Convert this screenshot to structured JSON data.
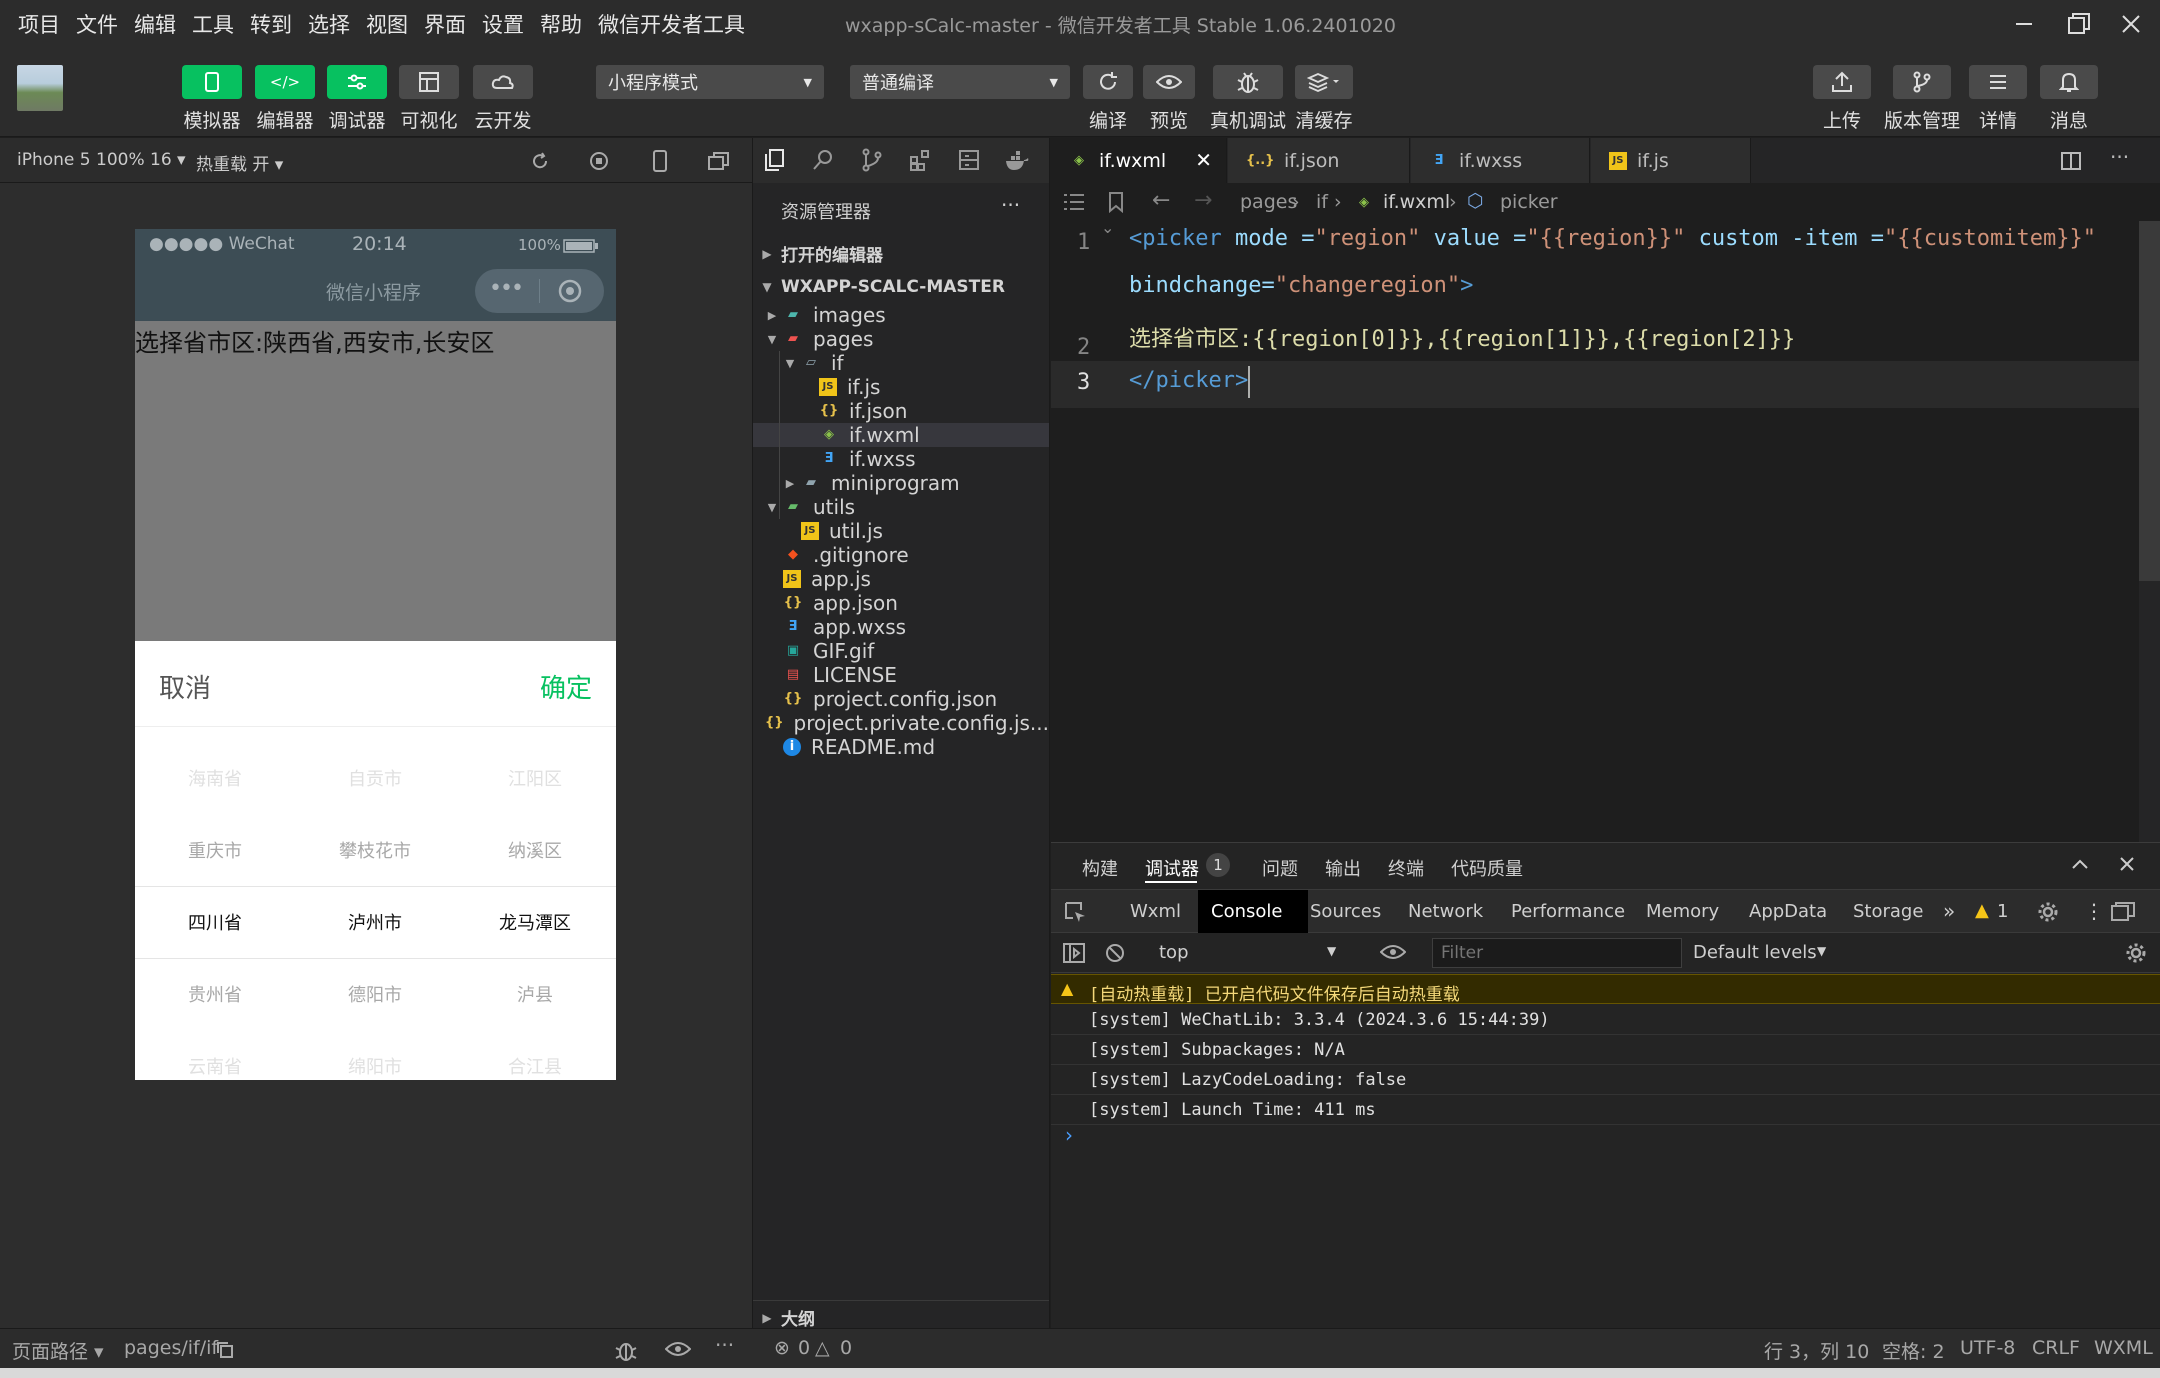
{
  "window": {
    "title": "wxapp-sCalc-master - 微信开发者工具 Stable 1.06.2401020"
  },
  "menu": [
    "项目",
    "文件",
    "编辑",
    "工具",
    "转到",
    "选择",
    "视图",
    "界面",
    "设置",
    "帮助",
    "微信开发者工具"
  ],
  "toolbar": {
    "simulator": "模拟器",
    "editor": "编辑器",
    "debugger": "调试器",
    "visual": "可视化",
    "cloud": "云开发",
    "mode": "小程序模式",
    "compile_mode": "普通编译",
    "compile": "编译",
    "preview": "预览",
    "real_debug": "真机调试",
    "clear_cache": "清缓存",
    "upload": "上传",
    "version": "版本管理",
    "details": "详情",
    "messages": "消息"
  },
  "simulator": {
    "device": "iPhone 5 100% 16",
    "hot_reload": "热重载 开",
    "status_wechat": "●●●●● WeChat",
    "status_time": "20:14",
    "status_battery": "100%",
    "nav_title": "微信小程序",
    "content_text": "选择省市区:陕西省,西安市,长安区",
    "cancel": "取消",
    "confirm": "确定",
    "rows": [
      [
        "海南省",
        "自贡市",
        "江阳区"
      ],
      [
        "重庆市",
        "攀枝花市",
        "纳溪区"
      ],
      [
        "四川省",
        "泸州市",
        "龙马潭区"
      ],
      [
        "贵州省",
        "德阳市",
        "泸县"
      ],
      [
        "云南省",
        "绵阳市",
        "合江县"
      ]
    ]
  },
  "explorer": {
    "title": "资源管理器",
    "open_editors": "打开的编辑器",
    "project": "WXAPP-SCALC-MASTER",
    "outline": "大纲",
    "items": [
      {
        "label": "images",
        "icon": "folder-images",
        "level": 1,
        "arrow": "▸"
      },
      {
        "label": "pages",
        "icon": "folder-pages",
        "level": 1,
        "arrow": "▾"
      },
      {
        "label": "if",
        "icon": "folder-open",
        "level": 2,
        "arrow": "▾"
      },
      {
        "label": "if.js",
        "icon": "js",
        "level": 3,
        "arrow": ""
      },
      {
        "label": "if.json",
        "icon": "json",
        "level": 3,
        "arrow": ""
      },
      {
        "label": "if.wxml",
        "icon": "wxml",
        "level": 3,
        "arrow": ""
      },
      {
        "label": "if.wxss",
        "icon": "wxss",
        "level": 3,
        "arrow": ""
      },
      {
        "label": "miniprogram",
        "icon": "folder",
        "level": 2,
        "arrow": "▸"
      },
      {
        "label": "utils",
        "icon": "folder-utils",
        "level": 1,
        "arrow": "▾"
      },
      {
        "label": "util.js",
        "icon": "js",
        "level": 2,
        "arrow": ""
      },
      {
        "label": ".gitignore",
        "icon": "git",
        "level": 1,
        "arrow": ""
      },
      {
        "label": "app.js",
        "icon": "js",
        "level": 1,
        "arrow": ""
      },
      {
        "label": "app.json",
        "icon": "json",
        "level": 1,
        "arrow": ""
      },
      {
        "label": "app.wxss",
        "icon": "wxss",
        "level": 1,
        "arrow": ""
      },
      {
        "label": "GIF.gif",
        "icon": "gif",
        "level": 1,
        "arrow": ""
      },
      {
        "label": "LICENSE",
        "icon": "license",
        "level": 1,
        "arrow": ""
      },
      {
        "label": "project.config.json",
        "icon": "json",
        "level": 1,
        "arrow": ""
      },
      {
        "label": "project.private.config.js...",
        "icon": "json",
        "level": 1,
        "arrow": ""
      },
      {
        "label": "README.md",
        "icon": "info",
        "level": 1,
        "arrow": ""
      }
    ]
  },
  "editor": {
    "tabs": [
      "if.wxml",
      "if.json",
      "if.wxss",
      "if.js"
    ],
    "breadcrumb": [
      "pages",
      "if",
      "if.wxml",
      "picker"
    ],
    "line_numbers": [
      "1",
      "2",
      "3"
    ],
    "line1a_tag": "<picker",
    "line1a_attr1": " mode =",
    "line1a_val1": "\"region\"",
    "line1a_attr2": " value =",
    "line1a_val2": "\"{{region}}\"",
    "line1a_attr3": " custom -item =",
    "line1a_val3": "\"{{customitem}}\"",
    "line1b_attr": "bindchange=",
    "line1b_val": "\"changeregion\"",
    "line1b_close": ">",
    "line2": "选择省市区:{{region[0]}},{{region[1]}},{{region[2]}}",
    "line3": "</picker>"
  },
  "devtools": {
    "top_tabs": [
      "构建",
      "调试器",
      "问题",
      "输出",
      "终端",
      "代码质量"
    ],
    "badge": "1",
    "panel_tabs": [
      "Wxml",
      "Console",
      "Sources",
      "Network",
      "Performance",
      "Memory",
      "AppData",
      "Storage"
    ],
    "warning_count": "1",
    "context": "top",
    "filter_placeholder": "Filter",
    "levels": "Default levels",
    "console": [
      "[自动热重载] 已开启代码文件保存后自动热重载",
      "[system] WeChatLib: 3.3.4 (2024.3.6 15:44:39)",
      "[system] Subpackages: N/A",
      "[system] LazyCodeLoading: false",
      "[system] Launch Time: 411 ms"
    ]
  },
  "status": {
    "path_label": "页面路径",
    "path": "pages/if/if",
    "errors": "0",
    "warnings": "0",
    "position": "行 3，列 10",
    "indent": "空格: 2",
    "encoding": "UTF-8",
    "eol": "CRLF",
    "lang": "WXML"
  }
}
